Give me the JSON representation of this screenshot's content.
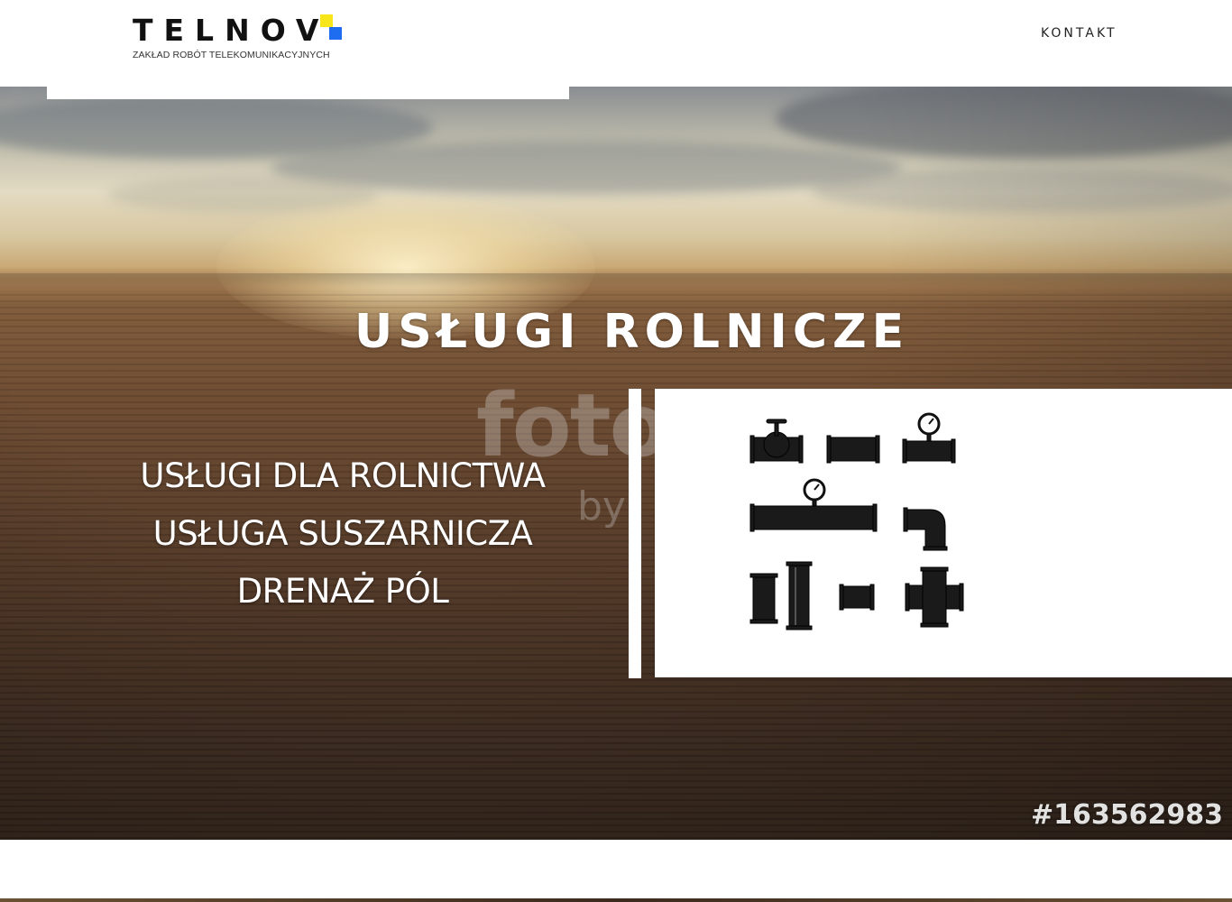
{
  "header": {
    "logo_text": "TELNOV",
    "logo_subtitle": "ZAKŁAD ROBÓT TELEKOMUNIKACYJNYCH",
    "logo_colors": {
      "yellow": "#f6e61a",
      "blue": "#1e6cf0"
    },
    "nav": {
      "contact_label": "KONTAKT"
    }
  },
  "hero": {
    "title": "USŁUGI ROLNICZE",
    "services": [
      "USŁUGI DLA ROLNICTWA",
      "USŁUGA SUSZARNICZA",
      "DRENAŻ PÓL"
    ],
    "watermark_text": "foto",
    "watermark_by": "by",
    "stock_id": "#163562983",
    "panel_icons": [
      "pipe-valve-icon",
      "pipe-coupling-icon",
      "pipe-gauge-icon",
      "pipe-long-gauge-icon",
      "pipe-elbow-icon",
      "pipe-vertical-short-icon",
      "pipe-vertical-tall-icon",
      "pipe-reducer-icon",
      "pipe-cross-icon"
    ]
  }
}
